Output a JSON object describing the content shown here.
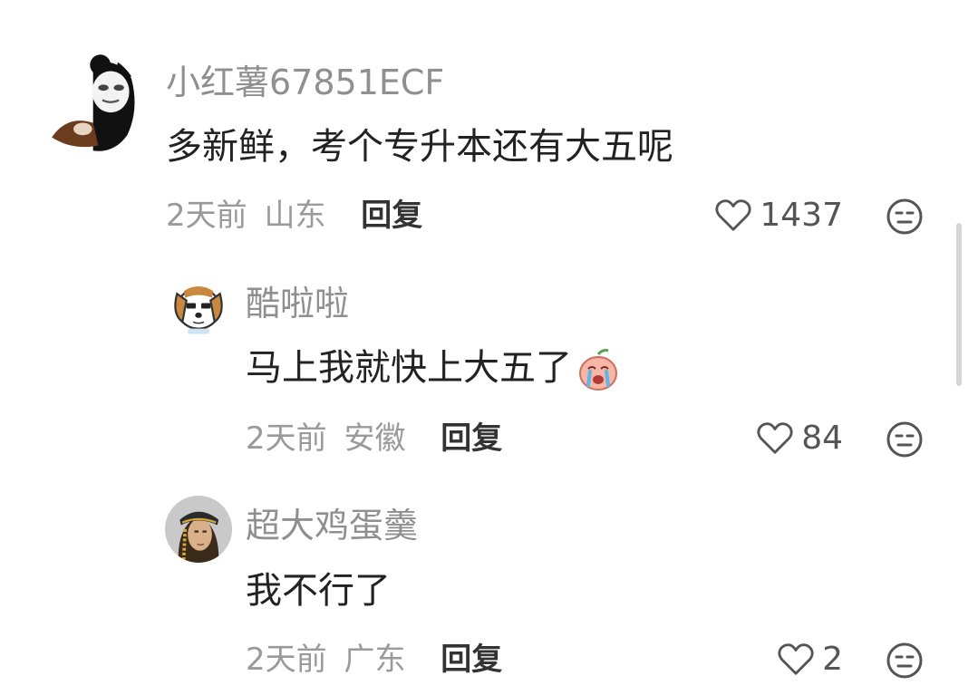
{
  "comments": [
    {
      "username": "小红薯67851ECF",
      "content": "多新鲜，考个专升本还有大五呢",
      "time": "2天前",
      "location": "山东",
      "reply_label": "回复",
      "likes": "1437",
      "avatar": "panda-meme-avatar"
    },
    {
      "username": "酷啦啦",
      "content": "马上我就快上大五了",
      "time": "2天前",
      "location": "安徽",
      "reply_label": "回复",
      "likes": "84",
      "avatar": "cartoon-dog-avatar",
      "emoji": "crying-peach-emoji"
    },
    {
      "username": "超大鸡蛋羹",
      "content": "我不行了",
      "time": "2天前",
      "location": "广东",
      "reply_label": "回复",
      "likes": "2",
      "avatar": "bandana-person-avatar"
    }
  ],
  "colors": {
    "username": "#8f8f8f",
    "content": "#222222",
    "meta": "#9a9a9a",
    "reply": "#333333"
  }
}
